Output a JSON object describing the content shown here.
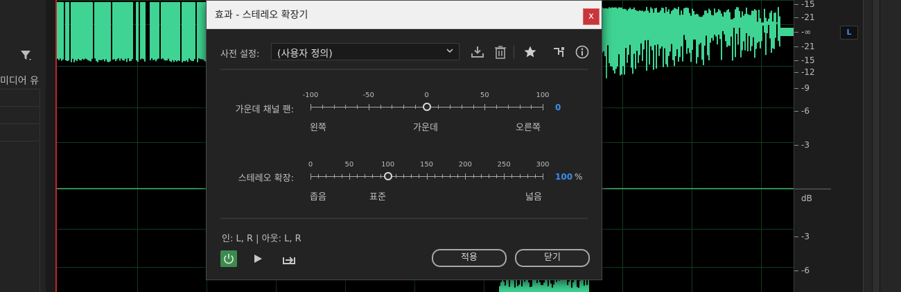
{
  "left_panel": {
    "label": "미디어 유"
  },
  "ruler": {
    "ticks_top": [
      "-15",
      "-21",
      "-∞",
      "-21",
      "-15",
      "-12",
      "-9",
      "-6",
      "-3"
    ],
    "db_label": "dB",
    "ticks_bottom": [
      "-3",
      "-6"
    ]
  },
  "channel_label": "L",
  "dialog": {
    "title": "효과 - 스테레오 확장기",
    "close": "x",
    "preset": {
      "label": "사전 설정:",
      "value": "(사용자 정의)"
    },
    "center_pan": {
      "label": "가운데 채널 팬:",
      "scale": [
        "-100",
        "-50",
        "0",
        "50",
        "100"
      ],
      "value_label": "0",
      "value": 0,
      "min": -100,
      "max": 100,
      "left_label": "왼쪽",
      "mid_label": "가운데",
      "right_label": "오른쪽"
    },
    "stereo_expand": {
      "label": "스테레오 확장:",
      "scale": [
        "0",
        "50",
        "100",
        "150",
        "200",
        "250",
        "300"
      ],
      "value_label": "100",
      "unit": "%",
      "value": 100,
      "min": 0,
      "max": 300,
      "narrow_label": "좁음",
      "standard_label": "표준",
      "wide_label": "넓음"
    },
    "io": "인: L, R | 아웃: L, R",
    "apply": "적용",
    "close_button": "닫기"
  },
  "colors": {
    "waveform": "#3fd493",
    "accent_value": "#3a8ef0",
    "close": "#c8363a",
    "power": "#3d8a4e"
  }
}
